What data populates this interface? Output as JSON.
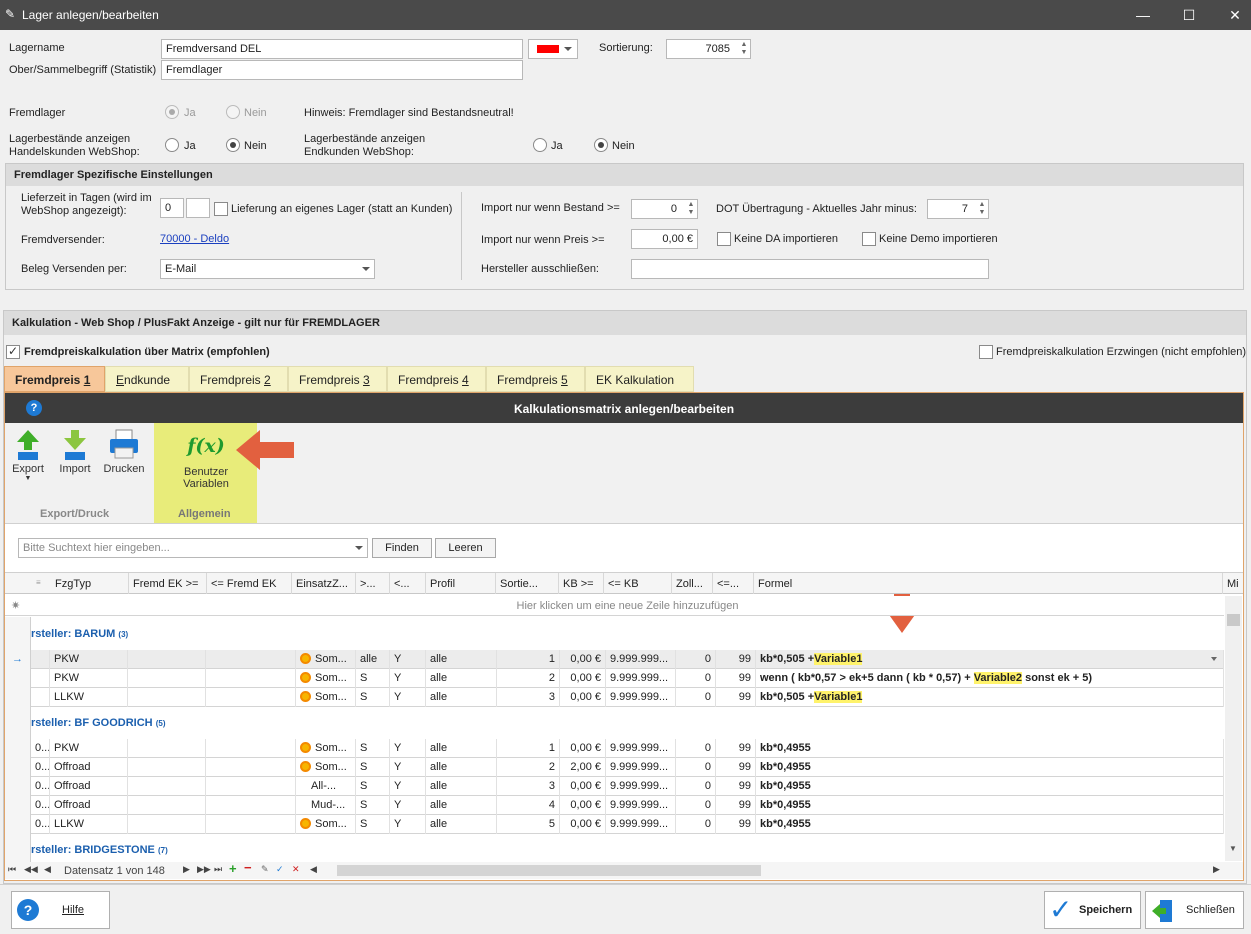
{
  "window": {
    "title": "Lager anlegen/bearbeiten"
  },
  "form": {
    "lagername_label": "Lagername",
    "lagername_value": "Fremdversand DEL",
    "ober_label": "Ober/Sammelbegriff (Statistik)",
    "ober_value": "Fremdlager",
    "sortierung_label": "Sortierung:",
    "sortierung_value": "7085",
    "color_value": "#ff0000",
    "fremdlager_label": "Fremdlager",
    "ja": "Ja",
    "nein": "Nein",
    "hinweis": "Hinweis: Fremdlager sind Bestandsneutral!",
    "handel_label1": "Lagerbestände anzeigen",
    "handel_label2": "Handelskunden WebShop:",
    "end_label1": "Lagerbestände anzeigen",
    "end_label2": "Endkunden WebShop:"
  },
  "spezifisch": {
    "title": "Fremdlager Spezifische Einstellungen",
    "lieferzeit_label1": "Lieferzeit in Tagen (wird im",
    "lieferzeit_label2": "WebShop angezeigt):",
    "lieferzeit_value": "0",
    "lieferung_label": "Lieferung an eigenes Lager (statt an Kunden)",
    "fremdversender_label": "Fremdversender:",
    "fremdversender_value": "70000 - Deldo",
    "beleg_label": "Beleg Versenden per:",
    "beleg_value": "E-Mail",
    "import_bestand_label": "Import nur wenn Bestand >=",
    "import_bestand_value": "0",
    "import_preis_label": "Import nur wenn Preis >=",
    "import_preis_value": "0,00 €",
    "hersteller_label": "Hersteller ausschließen:",
    "hersteller_value": "",
    "dot_label": "DOT Übertragung - Aktuelles Jahr minus:",
    "dot_value": "7",
    "keine_da": "Keine DA importieren",
    "keine_demo": "Keine Demo importieren"
  },
  "kalk": {
    "title": "Kalkulation - Web Shop / PlusFakt Anzeige - gilt nur für FREMDLAGER",
    "matrix_label": "Fremdpreiskalkulation über Matrix (empfohlen)",
    "erzwingen_label": "Fremdpreiskalkulation Erzwingen (nicht empfohlen)",
    "tabs": [
      "Fremdpreis 1",
      "Endkunde",
      "Fremdpreis 2",
      "Fremdpreis 3",
      "Fremdpreis 4",
      "Fremdpreis 5",
      "EK Kalkulation"
    ],
    "panel_title": "Kalkulationsmatrix anlegen/bearbeiten",
    "ribbon": {
      "export": "Export",
      "import": "Import",
      "drucken": "Drucken",
      "group1": "Export/Druck",
      "benutzer1": "Benutzer",
      "benutzer2": "Variablen",
      "group2": "Allgemein"
    },
    "search_placeholder": "Bitte Suchtext hier eingeben...",
    "finden": "Finden",
    "leeren": "Leeren",
    "columns": [
      "FzgTyp",
      "Fremd EK >=",
      "<= Fremd EK",
      "EinsatzZ...",
      ">...",
      "<...",
      "Profil",
      "Sortie...",
      "KB >=",
      "<= KB",
      "Zoll...",
      "<=...",
      "Formel",
      "Mi"
    ],
    "newrow": "Hier klicken um eine neue Zeile hinzuzufügen",
    "groups": [
      {
        "name": "rsteller: BARUM",
        "count": "(3)"
      },
      {
        "name": "rsteller: BF GOODRICH",
        "count": "(5)"
      },
      {
        "name": "rsteller: BRIDGESTONE",
        "count": "(7)"
      }
    ],
    "rows_barum": [
      {
        "pre": "",
        "typ": "PKW",
        "einsatz": "Som...",
        "gt": "alle",
        "lt": "Y",
        "profil": "alle",
        "sort": "1",
        "kb": "0,00 €",
        "lkb": "9.999.999...",
        "zoll": "0",
        "le": "99",
        "f1": "kb*0,505 +",
        "var": "Variable1",
        "f2": ""
      },
      {
        "pre": "",
        "typ": "PKW",
        "einsatz": "Som...",
        "gt": "S",
        "lt": "Y",
        "profil": "alle",
        "sort": "2",
        "kb": "0,00 €",
        "lkb": "9.999.999...",
        "zoll": "0",
        "le": "99",
        "f1": "wenn ( kb*0,57 > ek+5 dann ( kb * 0,57) + ",
        "var": "Variable2",
        "f2": " sonst ek + 5)"
      },
      {
        "pre": "",
        "typ": "LLKW",
        "einsatz": "Som...",
        "gt": "S",
        "lt": "Y",
        "profil": "alle",
        "sort": "3",
        "kb": "0,00 €",
        "lkb": "9.999.999...",
        "zoll": "0",
        "le": "99",
        "f1": "kb*0,505 +",
        "var": "Variable1",
        "f2": ""
      }
    ],
    "rows_bf": [
      {
        "pre": "0...",
        "typ": "PKW",
        "einsatz": "Som...",
        "gt": "S",
        "lt": "Y",
        "profil": "alle",
        "sort": "1",
        "kb": "0,00 €",
        "lkb": "9.999.999...",
        "zoll": "0",
        "le": "99",
        "f1": "kb*0,4955"
      },
      {
        "pre": "0...",
        "typ": "Offroad",
        "einsatz": "Som...",
        "gt": "S",
        "lt": "Y",
        "profil": "alle",
        "sort": "2",
        "kb": "2,00 €",
        "lkb": "9.999.999...",
        "zoll": "0",
        "le": "99",
        "f1": "kb*0,4955"
      },
      {
        "pre": "0...",
        "typ": "Offroad",
        "einsatz": "All-...",
        "gt": "S",
        "lt": "Y",
        "profil": "alle",
        "sort": "3",
        "kb": "0,00 €",
        "lkb": "9.999.999...",
        "zoll": "0",
        "le": "99",
        "f1": "kb*0,4955"
      },
      {
        "pre": "0...",
        "typ": "Offroad",
        "einsatz": "Mud-...",
        "gt": "S",
        "lt": "Y",
        "profil": "alle",
        "sort": "4",
        "kb": "0,00 €",
        "lkb": "9.999.999...",
        "zoll": "0",
        "le": "99",
        "f1": "kb*0,4955"
      },
      {
        "pre": "0...",
        "typ": "LLKW",
        "einsatz": "Som...",
        "gt": "S",
        "lt": "Y",
        "profil": "alle",
        "sort": "5",
        "kb": "0,00 €",
        "lkb": "9.999.999...",
        "zoll": "0",
        "le": "99",
        "f1": "kb*0,4955"
      }
    ],
    "navigator": "Datensatz 1 von 148"
  },
  "footer": {
    "hilfe": "Hilfe",
    "speichern": "Speichern",
    "schliessen": "Schließen"
  }
}
